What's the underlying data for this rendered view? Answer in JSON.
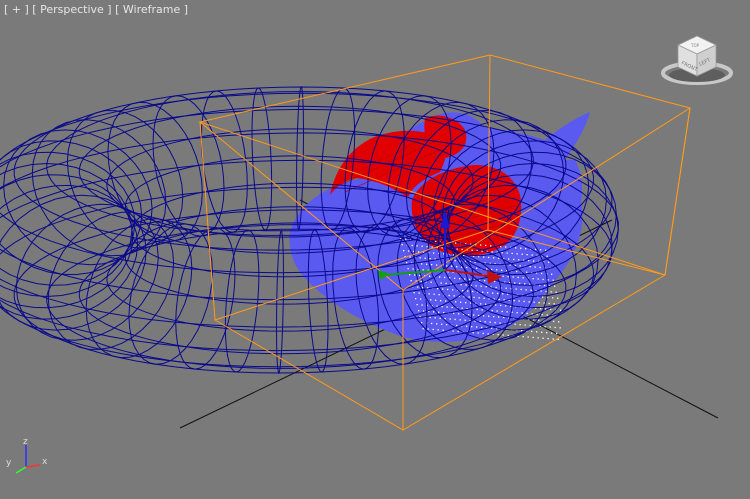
{
  "viewport": {
    "menu_plus": "[ + ]",
    "view_name": "[ Perspective ]",
    "shading_mode": "[ Wireframe ]"
  },
  "viewcube": {
    "front_label": "FRONT",
    "left_label": "LEFT",
    "top_label": "TOP"
  },
  "axis_tripod": {
    "x_label": "x",
    "y_label": "y",
    "z_label": "z"
  },
  "colors": {
    "background": "#7a7a7a",
    "torus_wire": "#0a0a8c",
    "teapot_fill": "#5a5af0",
    "fluid_red": "#e00000",
    "bounding_box": "#ff9a1a",
    "grid_line": "#101010",
    "particles": "#ffffff"
  }
}
